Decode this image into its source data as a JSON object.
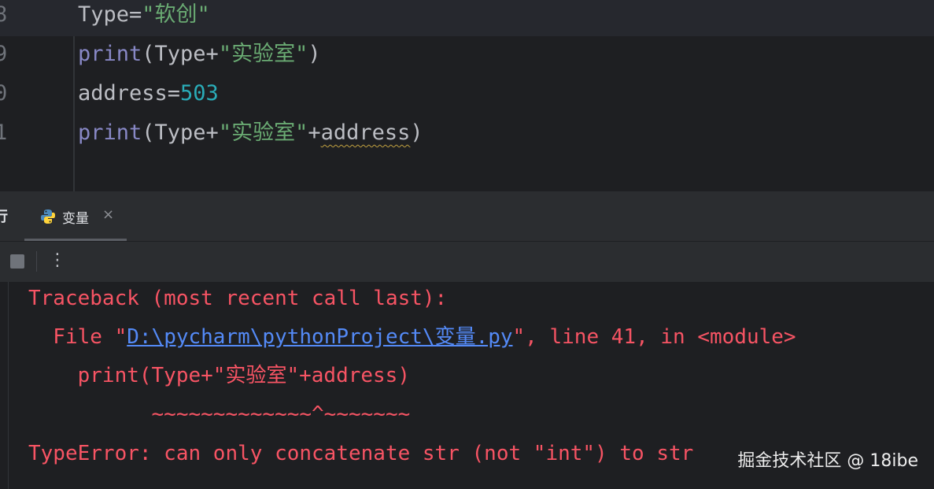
{
  "editor": {
    "lines": [
      {
        "number": "8",
        "parts": [
          {
            "t": "Type=",
            "c": "plain"
          },
          {
            "t": "\"软创\"",
            "c": "str"
          }
        ]
      },
      {
        "number": "9",
        "parts": [
          {
            "t": "print",
            "c": "fn"
          },
          {
            "t": "(Type+",
            "c": "plain"
          },
          {
            "t": "\"实验室\"",
            "c": "str"
          },
          {
            "t": ")",
            "c": "plain"
          }
        ]
      },
      {
        "number": "0",
        "parts": [
          {
            "t": "address=",
            "c": "plain"
          },
          {
            "t": "503",
            "c": "num"
          }
        ]
      },
      {
        "number": "1",
        "parts": [
          {
            "t": "print",
            "c": "fn"
          },
          {
            "t": "(Type+",
            "c": "plain"
          },
          {
            "t": "\"实验室\"",
            "c": "str"
          },
          {
            "t": "+",
            "c": "plain"
          },
          {
            "t": "address",
            "c": "warn"
          },
          {
            "t": ")",
            "c": "plain"
          }
        ]
      }
    ]
  },
  "run_panel": {
    "tool_label": "行",
    "tab_label": "变量",
    "tab_close": "×",
    "icons": {
      "tab": "python-icon",
      "stop": "stop-icon",
      "more": "more-vertical-icon"
    }
  },
  "console": {
    "line1": "Traceback (most recent call last):",
    "line2_prefix": "  File \"",
    "line2_link": "D:\\pycharm\\pythonProject\\变量.py",
    "line2_suffix": "\", line 41, in <module>",
    "line3": "    print(Type+\"实验室\"+address)",
    "line4": "          ~~~~~~~~~~~~~^~~~~~~~",
    "line5": "TypeError: can only concatenate str (not \"int\") to str"
  },
  "watermark": "掘金技术社区 @ 18ibe",
  "colors": {
    "error": "#f75464",
    "link": "#548af7",
    "string": "#6aab73",
    "number": "#2aacb8",
    "function": "#8888c6"
  }
}
